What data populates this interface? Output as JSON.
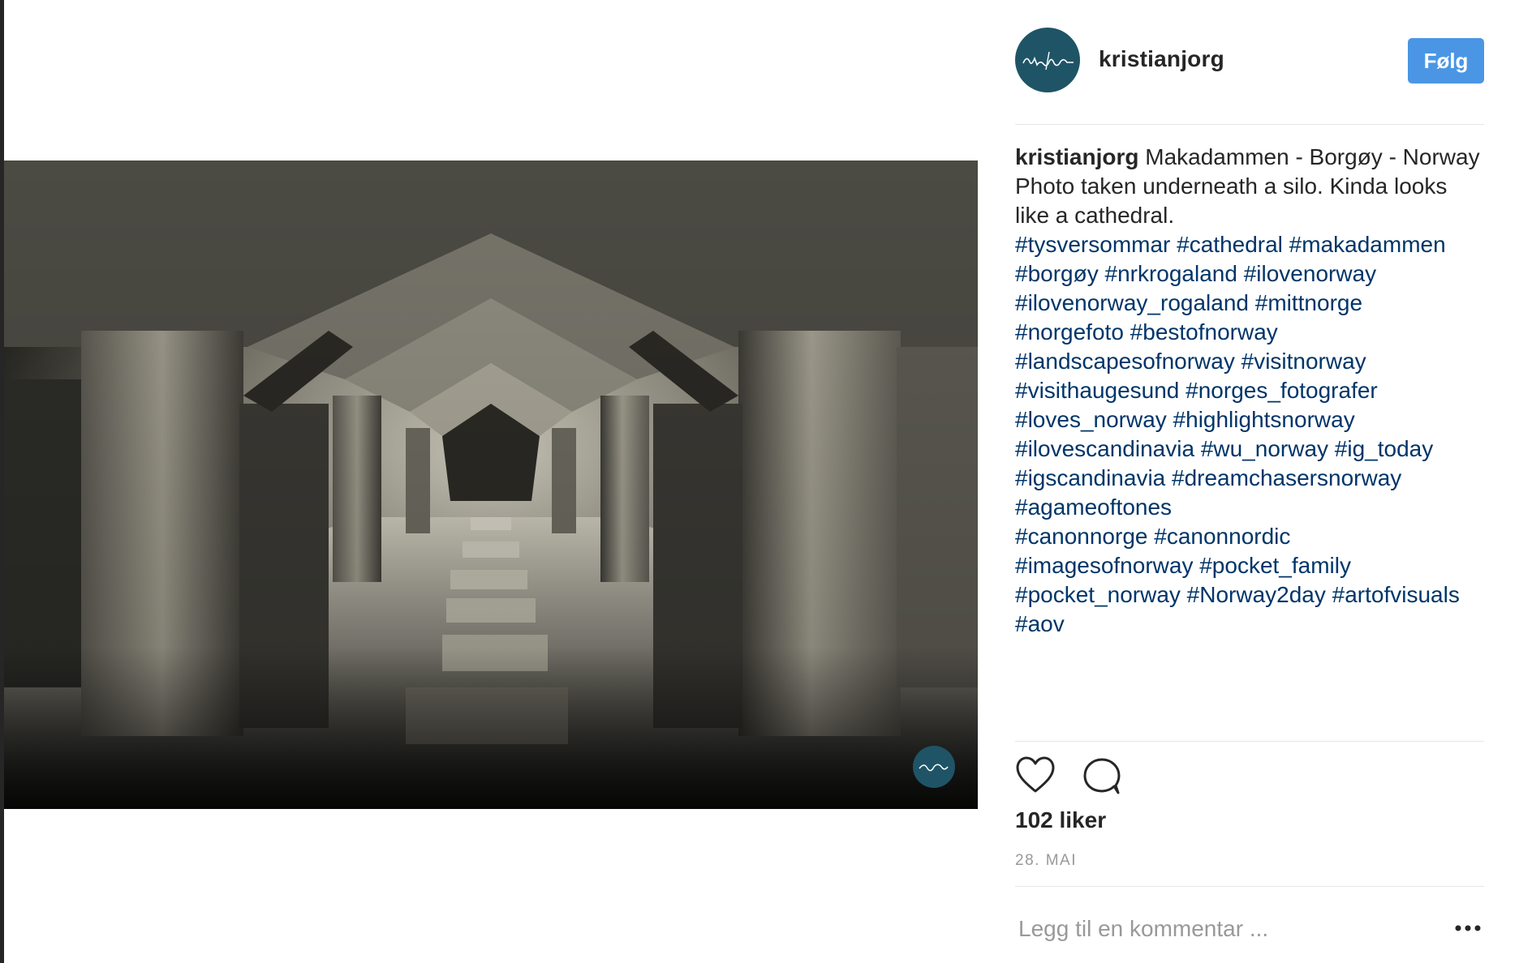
{
  "post": {
    "username": "kristianjorg",
    "follow_label": "Følg",
    "caption_user": "kristianjorg",
    "caption_title": " Makadammen - Borgøy - Norway",
    "caption_text": "Photo taken underneath a silo. Kinda looks like a cathedral.",
    "hashtag_lines": [
      "#tysversommar #cathedral #makadammen",
      "#borgøy #nrkrogaland #ilovenorway",
      "#ilovenorway_rogaland #mittnorge",
      "#norgefoto #bestofnorway",
      "#landscapesofnorway #visitnorway",
      "#visithaugesund #norges_fotografer",
      "#loves_norway #highlightsnorway",
      "#ilovescandinavia #wu_norway #ig_today",
      "#igscandinavia #dreamchasersnorway",
      "#agameoftones",
      "#canonnorge #canonnordic",
      "#imagesofnorway #pocket_family",
      "#pocket_norway #Norway2day #artofvisuals",
      "#aov"
    ],
    "likes": "102 liker",
    "date": "28. MAI",
    "comment_placeholder": "Legg til en kommentar ..."
  },
  "icons": {
    "like": "heart-icon",
    "comment": "comment-bubble-icon",
    "more": "more-options-icon"
  },
  "colors": {
    "follow_button": "#4a96e4",
    "hashtag": "#003569",
    "avatar_bg": "#1f5467",
    "text": "#262626",
    "muted": "#999999"
  }
}
